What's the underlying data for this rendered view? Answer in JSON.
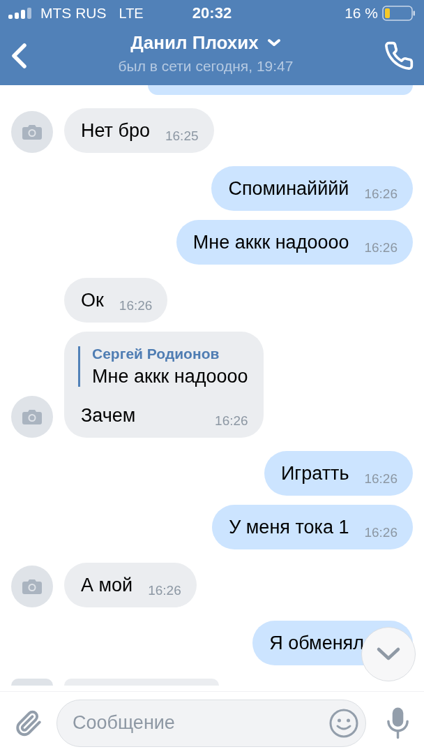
{
  "status_bar": {
    "carrier": "MTS RUS",
    "network": "LTE",
    "time": "20:32",
    "battery": "16 %"
  },
  "header": {
    "title": "Данил Плохих",
    "subtitle": "был в сети сегодня, 19:47"
  },
  "messages": [
    {
      "kind": "clipped",
      "outgoing": true,
      "avatar": false
    },
    {
      "kind": "text",
      "outgoing": false,
      "avatar": true,
      "text": "Нет бро",
      "time": "16:25"
    },
    {
      "kind": "text",
      "outgoing": true,
      "avatar": false,
      "text": "Споминайййй",
      "time": "16:26"
    },
    {
      "kind": "text",
      "outgoing": true,
      "avatar": false,
      "text": "Мне аккк надоооо",
      "time": "16:26"
    },
    {
      "kind": "text",
      "outgoing": false,
      "avatar": false,
      "text": "Ок",
      "time": "16:26"
    },
    {
      "kind": "reply",
      "outgoing": false,
      "avatar": true,
      "reply_author": "Сергей Родионов",
      "reply_text": "Мне аккк надоооо",
      "text": "Зачем",
      "time": "16:26"
    },
    {
      "kind": "text",
      "outgoing": true,
      "avatar": false,
      "text": "Игратть",
      "time": "16:26"
    },
    {
      "kind": "text",
      "outgoing": true,
      "avatar": false,
      "text": "У меня тока 1",
      "time": "16:26"
    },
    {
      "kind": "text",
      "outgoing": false,
      "avatar": true,
      "text": "А мой",
      "time": "16:26"
    },
    {
      "kind": "text",
      "outgoing": true,
      "avatar": false,
      "text": "Я обменял"
    },
    {
      "kind": "clipped",
      "outgoing": false,
      "avatar": true
    }
  ],
  "composer": {
    "placeholder": "Сообщение"
  }
}
